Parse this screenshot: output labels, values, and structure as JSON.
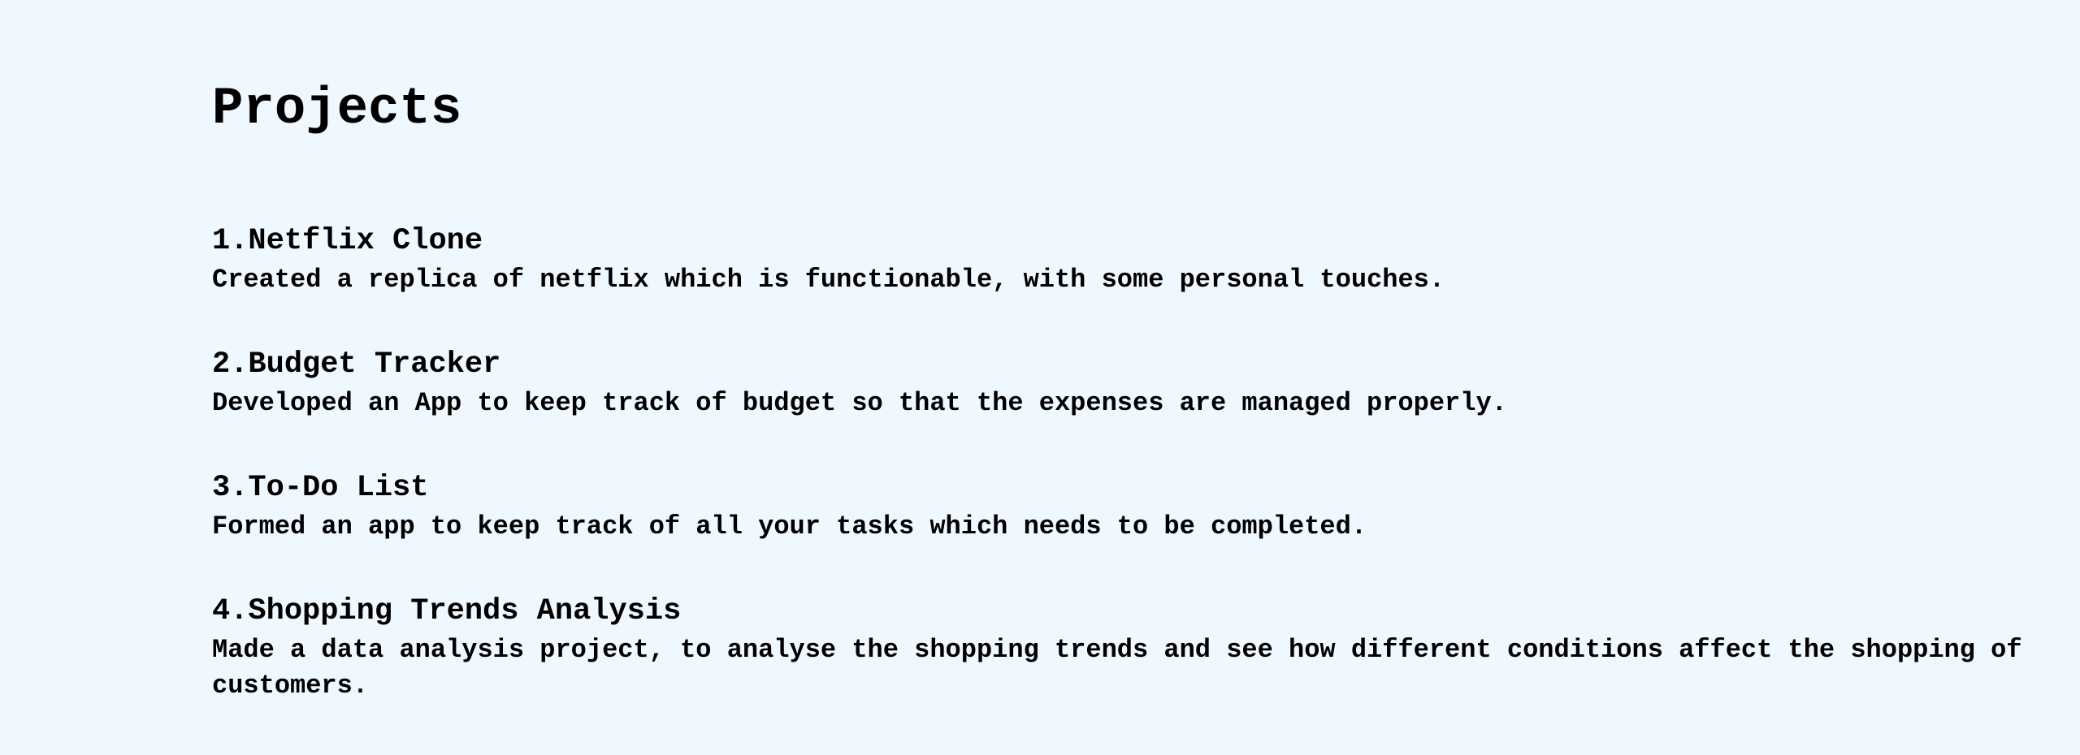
{
  "page": {
    "title": "Projects"
  },
  "projects": [
    {
      "title": "1.Netflix Clone",
      "description": "Created a replica of netflix which is functionable, with some personal touches."
    },
    {
      "title": "2.Budget Tracker",
      "description": "Developed an App to keep track of budget so that the expenses are managed properly."
    },
    {
      "title": "3.To-Do List",
      "description": "Formed an app to keep track of all your tasks which needs to be completed."
    },
    {
      "title": "4.Shopping Trends Analysis",
      "description": "Made a data analysis project, to analyse the shopping trends and see how different conditions affect the shopping of customers."
    }
  ]
}
